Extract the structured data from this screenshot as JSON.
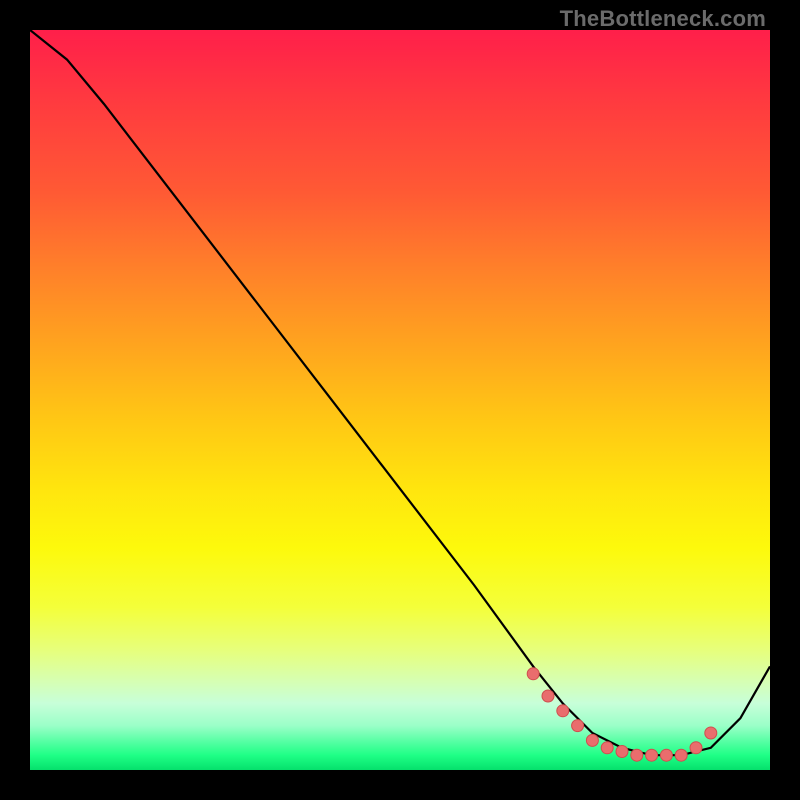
{
  "watermark": "TheBottleneck.com",
  "chart_data": {
    "type": "line",
    "title": "",
    "xlabel": "",
    "ylabel": "",
    "xlim": [
      0,
      100
    ],
    "ylim": [
      0,
      100
    ],
    "grid": false,
    "legend": false,
    "background": "rainbow-vertical",
    "series": [
      {
        "name": "curve",
        "x": [
          0,
          5,
          10,
          20,
          30,
          40,
          50,
          60,
          68,
          72,
          76,
          80,
          84,
          88,
          92,
          96,
          100
        ],
        "y": [
          100,
          96,
          90,
          77,
          64,
          51,
          38,
          25,
          14,
          9,
          5,
          3,
          2,
          2,
          3,
          7,
          14
        ]
      }
    ],
    "markers": {
      "name": "highlight-points",
      "color": "#e96d6d",
      "x": [
        68,
        70,
        72,
        74,
        76,
        78,
        80,
        82,
        84,
        86,
        88,
        90,
        92
      ],
      "y": [
        13,
        10,
        8,
        6,
        4,
        3,
        2.5,
        2,
        2,
        2,
        2,
        3,
        5
      ]
    }
  }
}
